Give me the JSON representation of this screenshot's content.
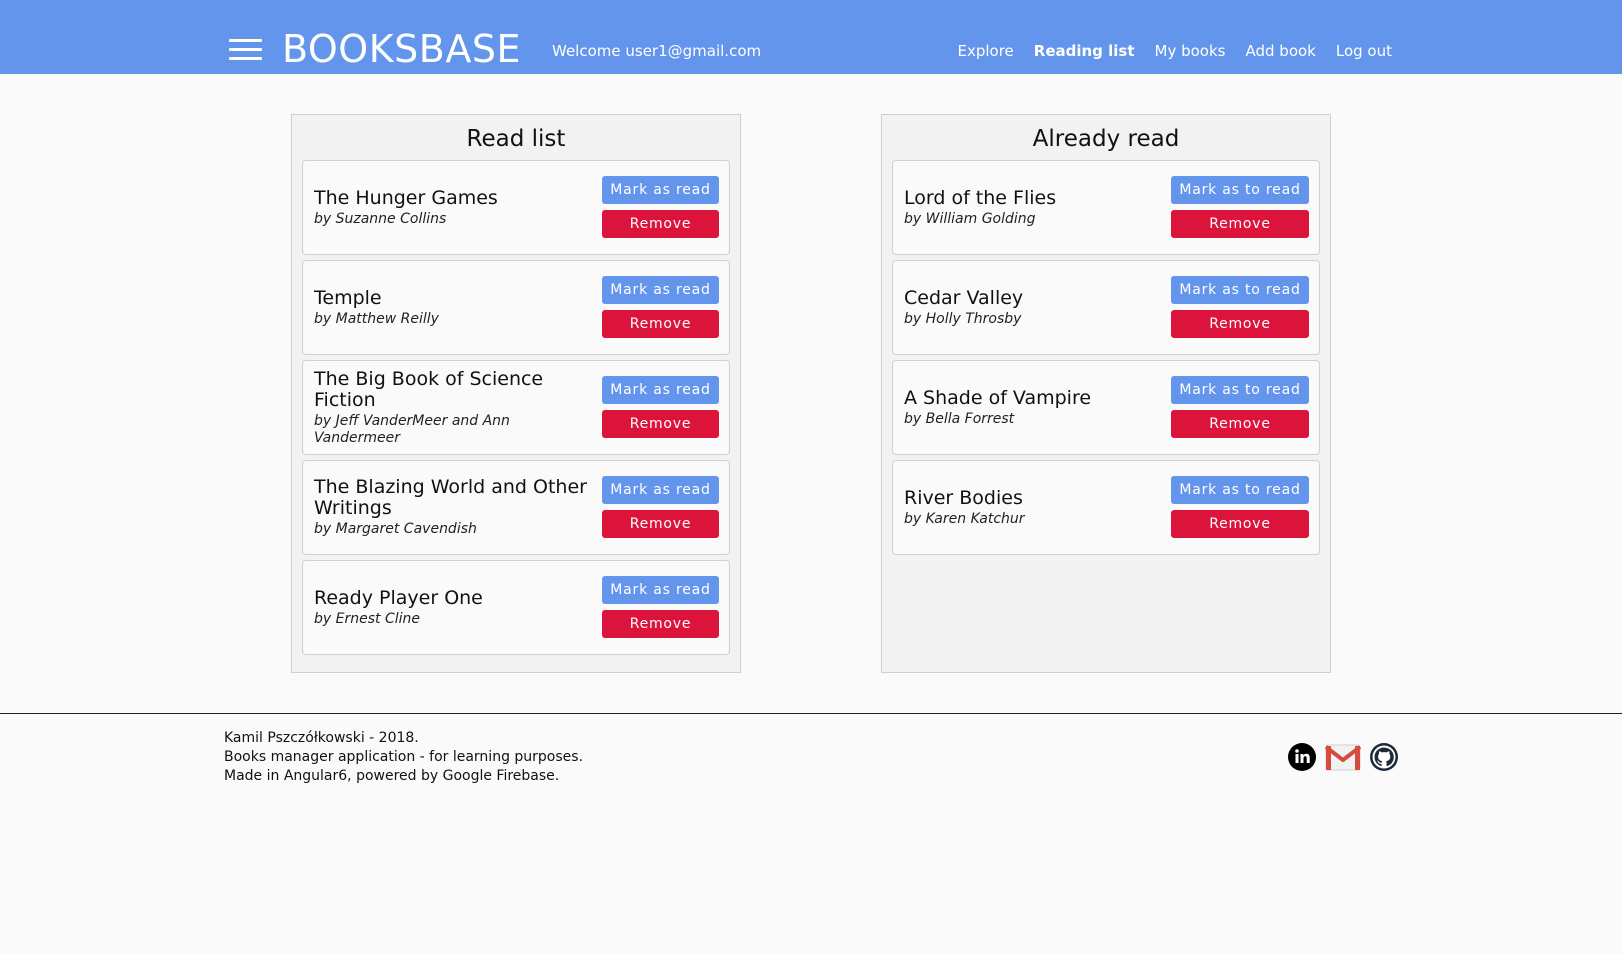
{
  "header": {
    "logo": "BOOKSBASE",
    "welcome": "Welcome user1@gmail.com",
    "nav": [
      {
        "label": "Explore"
      },
      {
        "label": "Reading list",
        "active": true
      },
      {
        "label": "My books"
      },
      {
        "label": "Add book"
      },
      {
        "label": "Log out"
      }
    ],
    "menu_icon": "hamburger-menu-icon",
    "color": "#6495ed"
  },
  "read_list": {
    "title": "Read list",
    "mark_label": "Mark as read",
    "remove_label": "Remove",
    "books": [
      {
        "title": "The Hunger Games",
        "author": "by Suzanne Collins"
      },
      {
        "title": "Temple",
        "author": "by Matthew Reilly"
      },
      {
        "title": "The Big Book of Science Fiction",
        "author": "by Jeff VanderMeer and Ann Vandermeer"
      },
      {
        "title": "The Blazing World and Other Writings",
        "author": "by Margaret Cavendish"
      },
      {
        "title": "Ready Player One",
        "author": "by Ernest Cline"
      }
    ]
  },
  "already_read": {
    "title": "Already read",
    "mark_label": "Mark as to read",
    "remove_label": "Remove",
    "books": [
      {
        "title": "Lord of the Flies",
        "author": "by William Golding"
      },
      {
        "title": "Cedar Valley",
        "author": "by Holly Throsby"
      },
      {
        "title": "A Shade of Vampire",
        "author": "by Bella Forrest"
      },
      {
        "title": "River Bodies",
        "author": "by Karen Katchur"
      }
    ]
  },
  "footer": {
    "lines": [
      "Kamil Pszczółkowski - 2018.",
      "Books manager application - for learning purposes.",
      "Made in Angular6, powered by Google Firebase."
    ],
    "social_icons": [
      "linkedin-icon",
      "gmail-icon",
      "github-icon"
    ]
  },
  "colors": {
    "primary": "#6495ed",
    "danger": "#dc143c",
    "background": "#fafafa",
    "panel": "#f2f2f2"
  }
}
